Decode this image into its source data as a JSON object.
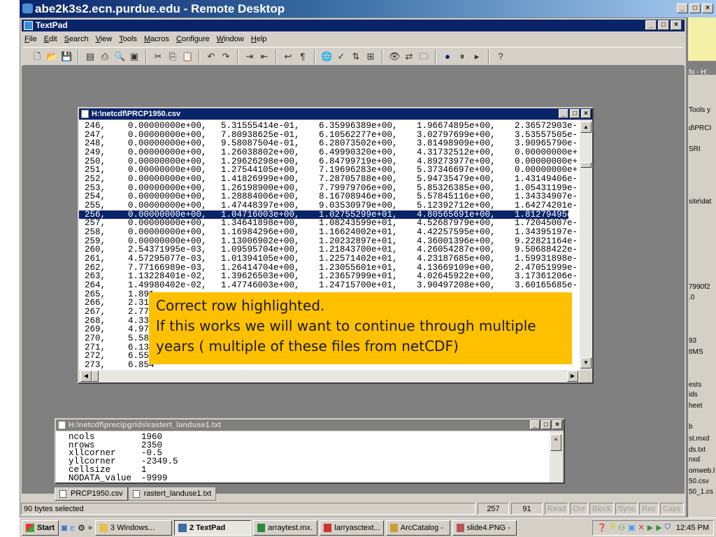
{
  "remote_desktop": {
    "title": "abe2k3s2.ecn.purdue.edu - Remote Desktop"
  },
  "textpad": {
    "title": "TextPad",
    "menu": [
      "File",
      "Edit",
      "Search",
      "View",
      "Tools",
      "Macros",
      "Configure",
      "Window",
      "Help"
    ],
    "toolbar_icons": [
      "new-icon",
      "open-icon",
      "save-icon",
      "|",
      "save-all-icon",
      "print-icon",
      "print-preview-icon",
      "properties-icon",
      "|",
      "cut-icon",
      "copy-icon",
      "paste-icon",
      "|",
      "undo-icon",
      "redo-icon",
      "|",
      "indent-icon",
      "outdent-icon",
      "|",
      "word-wrap-icon",
      "pilcrow-icon",
      "|",
      "browser-icon",
      "spell-check-icon",
      "sort-icon",
      "compare-icon",
      "|",
      "find-icon",
      "replace-icon",
      "find-in-files-icon",
      "|",
      "record-macro-icon",
      "pause-macro-icon",
      "play-macro-icon",
      "|",
      "context-help-icon"
    ]
  },
  "csv_window": {
    "title": "H:\\netcdf\\PRCP1950.csv",
    "selected_row": "256,",
    "rows": [
      [
        "246,",
        "0.00000000e+00,",
        "5.31555414e-01,",
        "6.35996389e+00,",
        "1.96674895e+00,",
        "2.36572903e-"
      ],
      [
        "247,",
        "0.00000000e+00,",
        "7.80938625e-01,",
        "6.10562277e+00,",
        "3.02797699e+00,",
        "3.53557505e-"
      ],
      [
        "248,",
        "0.00000000e+00,",
        "9.58087504e-01,",
        "6.28073502e+00,",
        "3.81498909e+00,",
        "3.90965790e-"
      ],
      [
        "249,",
        "0.00000000e+00,",
        "1.26038802e+00,",
        "6.49990320e+00,",
        "4.31732512e+00,",
        "0.00000000e+"
      ],
      [
        "250,",
        "0.00000000e+00,",
        "1.29626298e+00,",
        "6.84799719e+00,",
        "4.89273977e+00,",
        "0.00000000e+"
      ],
      [
        "251,",
        "0.00000000e+00,",
        "1.27544105e+00,",
        "7.19696283e+00,",
        "5.37346697e+00,",
        "0.00000000e+"
      ],
      [
        "252,",
        "0.00000000e+00,",
        "1.41826999e+00,",
        "7.28705788e+00,",
        "5.94735479e+00,",
        "1.43149406e-"
      ],
      [
        "253,",
        "0.00000000e+00,",
        "1.26198900e+00,",
        "7.79979706e+00,",
        "5.85326385e+00,",
        "1.05431199e-"
      ],
      [
        "254,",
        "0.00000000e+00,",
        "1.28884006e+00,",
        "8.16708946e+00,",
        "5.57845116e+00,",
        "1.34334907e-"
      ],
      [
        "255,",
        "0.00000000e+00,",
        "1.47448397e+00,",
        "9.03530979e+00,",
        "5.12392712e+00,",
        "1.64274201e-"
      ],
      [
        "256,",
        "0.00000000e+00,",
        "1.04716003e+00,",
        "1.02755299e+01,",
        "4.80565691e+00,",
        "1.81279495e-"
      ],
      [
        "257,",
        "0.00000000e+00,",
        "1.34641898e+00,",
        "1.08243599e+01,",
        "4.52687979e+00,",
        "1.72045007e-"
      ],
      [
        "258,",
        "0.00000000e+00,",
        "1.16984296e+00,",
        "1.16624002e+01,",
        "4.42257595e+00,",
        "1.34395197e-"
      ],
      [
        "259,",
        "0.00000000e+00,",
        "1.13006902e+00,",
        "1.20232897e+01,",
        "4.36001396e+00,",
        "9.22821164e-"
      ],
      [
        "260,",
        "2.54371995e-03,",
        "1.09595704e+00,",
        "1.21843700e+01,",
        "4.26054287e+00,",
        "9.50688422e-"
      ],
      [
        "261,",
        "4.57295077e-03,",
        "1.01394105e+00,",
        "1.22571402e+01,",
        "4.23187685e+00,",
        "1.59931898e-"
      ],
      [
        "262,",
        "7.77166989e-03,",
        "1.26414704e+00,",
        "1.23055601e+01,",
        "4.13669109e+00,",
        "2.47051999e-"
      ],
      [
        "263,",
        "1.13228401e-02,",
        "1.39626503e+00,",
        "1.23657999e+01,",
        "4.02645922e+00,",
        "3.17361206e-"
      ],
      [
        "264,",
        "1.49980402e-02,",
        "1.47746003e+00,",
        "1.24715700e+01,",
        "3.90497208e+00,",
        "3.60165685e-"
      ],
      [
        "265,",
        "1.891",
        "",
        "",
        "",
        ""
      ],
      [
        "266,",
        "2.318",
        "",
        "",
        "",
        ""
      ],
      [
        "267,",
        "2.776",
        "",
        "",
        "",
        ""
      ],
      [
        "268,",
        "4.331",
        "",
        "",
        "",
        ""
      ],
      [
        "269,",
        "4.976",
        "",
        "",
        "",
        ""
      ],
      [
        "270,",
        "5.589",
        "",
        "",
        "",
        ""
      ],
      [
        "271,",
        "6.134",
        "",
        "",
        "",
        ""
      ],
      [
        "272,",
        "6.559",
        "",
        "",
        "",
        ""
      ],
      [
        "273,",
        "6.854",
        "",
        "",
        "",
        ""
      ]
    ]
  },
  "callout": {
    "color": "#FFC000",
    "lines": [
      "Correct row highlighted.",
      "If this works we will want to continue through multiple",
      "years ( multiple of these files from netCDF)"
    ]
  },
  "grid_window": {
    "title": "H:\\netcdf\\precipgrids\\rastert_landuse1.txt",
    "rows": [
      [
        "ncols",
        "1960"
      ],
      [
        "nrows",
        "2350"
      ],
      [
        "xllcorner",
        "-0.5"
      ],
      [
        "yllcorner",
        "-2349.5"
      ],
      [
        "cellsize",
        "1"
      ],
      [
        "NODATA_value",
        "-9999"
      ]
    ]
  },
  "tabs": [
    {
      "label": "PRCP1950.csv",
      "active": true
    },
    {
      "label": "rastert_landuse1.txt",
      "active": false
    }
  ],
  "status": {
    "message": "90 bytes selected",
    "line": "257",
    "column": "91",
    "indicators": [
      "Read",
      "Ovr",
      "Block",
      "Sync",
      "Rec",
      "Caps"
    ]
  },
  "taskbar": {
    "start": "Start",
    "buttons": [
      "3 Windows...",
      "2 TextPad",
      "arraytest.mx...",
      "larryasctext....",
      "ArcCatalog - ...",
      "slide4.PNG - ..."
    ],
    "active": "2 TextPad",
    "clock": "12:45 PM"
  },
  "background_window": {
    "texts": [
      "fo - H:",
      "Tools  y",
      "d\\PRCI",
      "SRI",
      "site\\dat",
      "7990f2",
      ".0",
      "93",
      "tIMS",
      "ests",
      "ids",
      "heet",
      "b",
      "st.mxd",
      "ds.txt",
      "nxd",
      "omweb.l",
      "50.csv",
      "50_1.cs"
    ]
  },
  "colors": {
    "title_active": "#0A246A",
    "selection": "#0A246A",
    "chrome": "#D4D0C8",
    "mdi_background": "#808080"
  }
}
